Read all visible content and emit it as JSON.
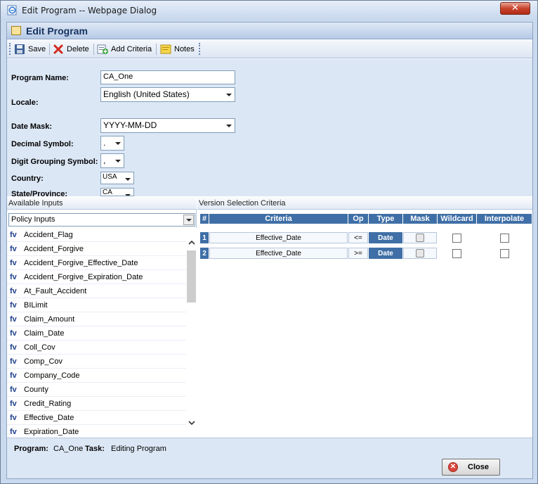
{
  "window": {
    "title": "Edit Program -- Webpage Dialog",
    "close_glyph": "✕"
  },
  "header": {
    "title": "Edit Program"
  },
  "toolbar": {
    "save": "Save",
    "delete": "Delete",
    "add_criteria": "Add Criteria",
    "notes": "Notes"
  },
  "form": {
    "program_name_label": "Program Name:",
    "program_name_value": "CA_One",
    "locale_label": "Locale:",
    "locale_value": "English (United States)",
    "date_mask_label": "Date Mask:",
    "date_mask_value": "YYYY-MM-DD",
    "decimal_label": "Decimal Symbol:",
    "decimal_value": ".",
    "digit_group_label": "Digit Grouping Symbol:",
    "digit_group_value": ",",
    "country_label": "Country:",
    "country_value": "USA",
    "state_label": "State/Province:",
    "state_value": "CA"
  },
  "inputs": {
    "heading": "Available Inputs",
    "filter_value": "Policy Inputs",
    "prefix": "fv",
    "items": [
      "Accident_Flag",
      "Accident_Forgive",
      "Accident_Forgive_Effective_Date",
      "Accident_Forgive_Expiration_Date",
      "At_Fault_Accident",
      "BILimit",
      "Claim_Amount",
      "Claim_Date",
      "Coll_Cov",
      "Comp_Cov",
      "Company_Code",
      "County",
      "Credit_Rating",
      "Effective_Date",
      "Expiration_Date"
    ]
  },
  "criteria": {
    "heading": "Version Selection Criteria",
    "columns": [
      "#",
      "Criteria",
      "Op",
      "Type",
      "Mask",
      "Wildcard",
      "Interpolate"
    ],
    "rows": [
      {
        "num": "1",
        "criteria": "Effective_Date",
        "op": "<=",
        "type": "Date"
      },
      {
        "num": "2",
        "criteria": "Effective_Date",
        "op": ">=",
        "type": "Date"
      }
    ]
  },
  "status": {
    "program_label": "Program:",
    "program_value": "CA_One",
    "task_label": "Task:",
    "task_value": "Editing Program"
  },
  "footer": {
    "close_label": "Close"
  },
  "colors": {
    "accent": "#3f6fa6",
    "panel_bg": "#dce7f5"
  }
}
